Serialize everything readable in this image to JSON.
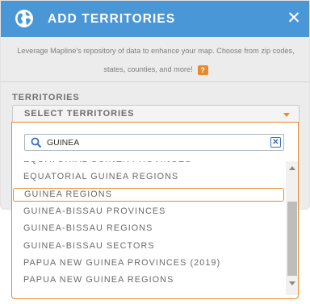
{
  "dialog": {
    "title": "ADD TERRITORIES",
    "close_label": "✕",
    "description_line1": "Leverage Mapline's repository of data to enhance your map. Choose from zip codes,",
    "description_line2": "states, counties, and more!",
    "help_label": "?"
  },
  "territories": {
    "label": "TERRITORIES",
    "select_placeholder": "SELECT TERRITORIES"
  },
  "search": {
    "value": "GUINEA",
    "clear_label": "✕"
  },
  "results": [
    "EQUATORIAL GUINEA PROVINCES",
    "EQUATORIAL GUINEA REGIONS",
    "GUINEA REGIONS",
    "GUINEA-BISSAU PROVINCES",
    "GUINEA-BISSAU REGIONS",
    "GUINEA-BISSAU SECTORS",
    "PAPUA NEW GUINEA PROVINCES (2019)",
    "PAPUA NEW GUINEA REGIONS"
  ],
  "highlighted_index": 2,
  "colors": {
    "header": "#4a97d8",
    "accent": "#e98a2a",
    "clear_button": "#3a6fc2"
  },
  "icons": {
    "header": "globe-icon",
    "close": "close-icon",
    "search": "search-icon",
    "clear": "clear-icon",
    "select": "chevron-down-icon"
  }
}
